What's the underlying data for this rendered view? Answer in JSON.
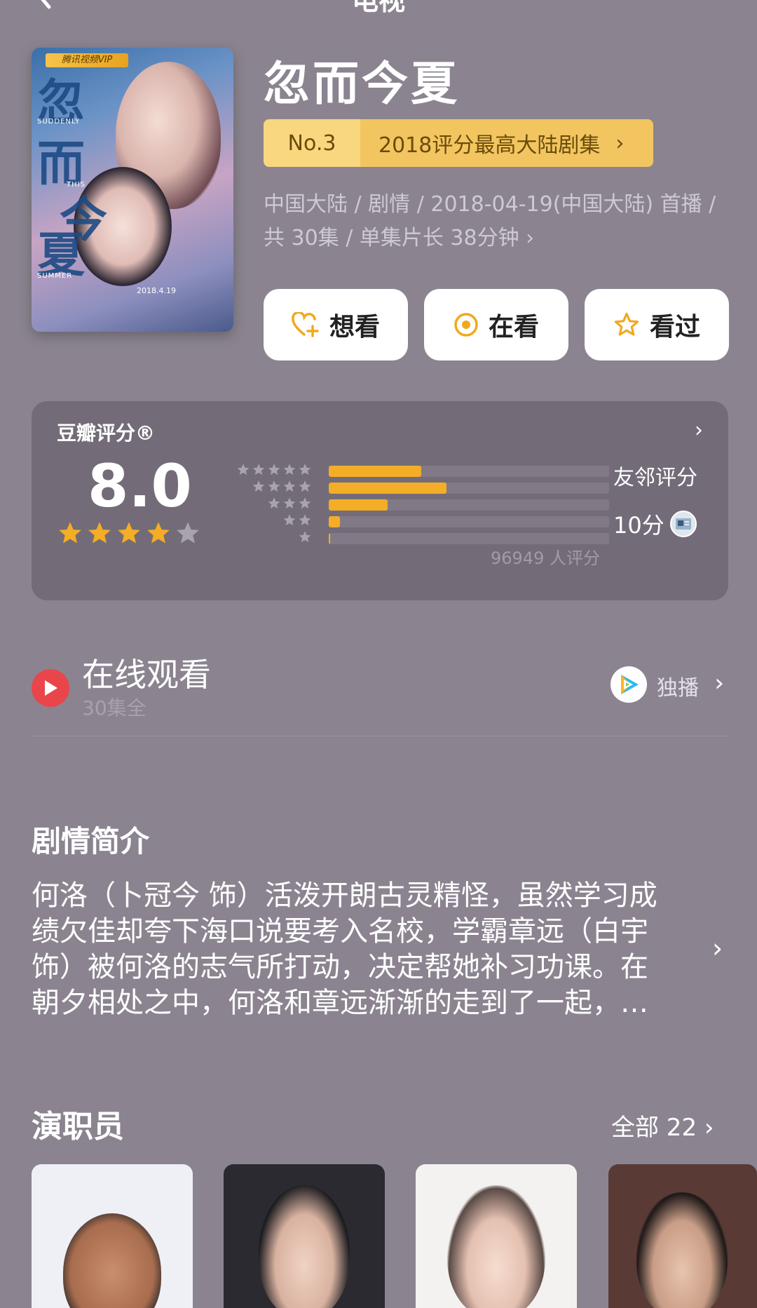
{
  "nav": {
    "title": "电视"
  },
  "show": {
    "title": "忽而今夏",
    "poster": {
      "vip_tag": "腾讯视频VIP",
      "title_chars": [
        "忽",
        "而",
        "今",
        "夏"
      ],
      "eng_top": "SUDDENLY",
      "eng_mid": "THIS",
      "eng_bottom": "SUMMER",
      "date": "2018.4.19"
    },
    "rank": {
      "no": "No.3",
      "text": "2018评分最高大陆剧集"
    },
    "meta_line1": "中国大陆 / 剧情 / 2018-04-19(中国大陆) 首播 /",
    "meta_line2": "共 30集 / 单集片长 38分钟"
  },
  "actions": {
    "want": "想看",
    "watching": "在看",
    "watched": "看过"
  },
  "rating": {
    "label": "豆瓣评分®",
    "score": "8.0",
    "stars_filled": 4,
    "distribution": [
      0.33,
      0.42,
      0.21,
      0.04,
      0.005
    ],
    "voters": "96949 人评分",
    "friends_label": "友邻评分",
    "friends_score": "10分"
  },
  "watch": {
    "title": "在线观看",
    "subtitle": "30集全",
    "exclusive": "独播"
  },
  "synopsis": {
    "title": "剧情简介",
    "lines": [
      "何洛（卜冠今 饰）活泼开朗古灵精怪，虽然学习成",
      "绩欠佳却夸下海口说要考入名校，学霸章远（白宇",
      "饰）被何洛的志气所打动，决定帮她补习功课。在",
      "朝夕相处之中，何洛和章远渐渐的走到了一起，…"
    ]
  },
  "cast": {
    "title": "演职员",
    "all": "全部 22"
  },
  "colors": {
    "accent": "#f4ad27",
    "background": "#8b8490",
    "card": "#736c78",
    "badge": "#f2c560"
  }
}
